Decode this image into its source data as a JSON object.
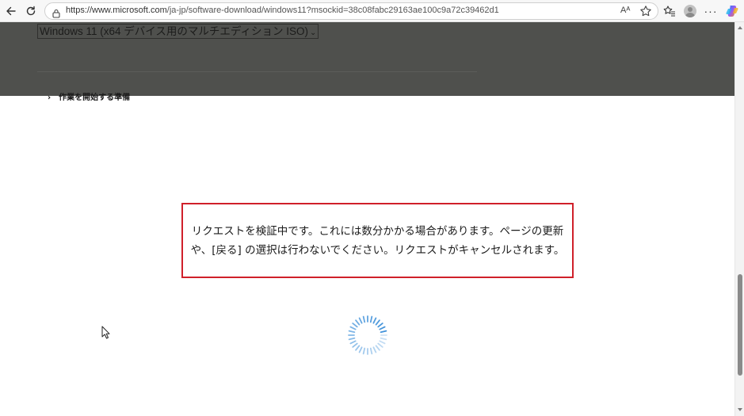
{
  "browser": {
    "url_host": "https://www.microsoft.com",
    "url_path": "/ja-jp/software-download/windows11?msockid=38c08fabc29163ae100c9a72c39462d1",
    "read_aloud_label": "Aᴬ"
  },
  "page": {
    "edition_select_value": "Windows 11 (x64 デバイス用のマルチエディション ISO)",
    "section_toggle_label": "作業を開始する準備",
    "message": "リクエストを検証中です。これには数分かかる場合があります。ページの更新や、[戻る] の選択は行わないでください。リクエストがキャンセルされます。"
  },
  "colors": {
    "overlay": "#4f504d",
    "message_border": "#d0202a",
    "spinner": "#3b8fd9"
  },
  "icons": {
    "back": "arrow-left-icon",
    "refresh": "refresh-icon",
    "site_info": "lock-icon",
    "favorite": "star-icon",
    "favorites_list": "favorites-icon",
    "profile": "avatar-icon",
    "more": "more-icon",
    "copilot": "copilot-icon",
    "loading": "spinner-icon",
    "cursor": "mouse-cursor-icon"
  }
}
